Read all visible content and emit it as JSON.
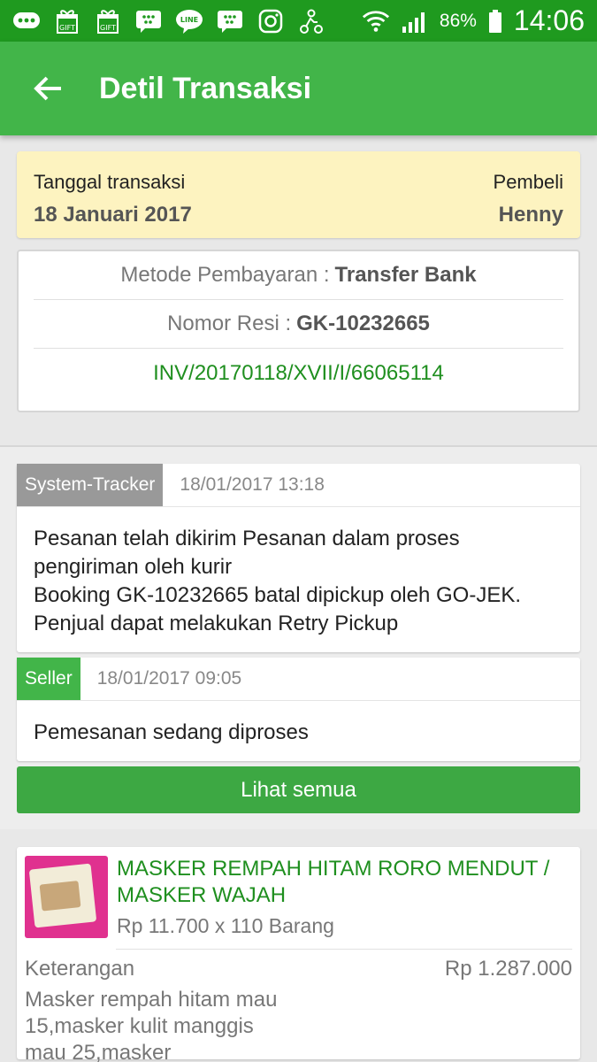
{
  "status_bar": {
    "battery": "86%",
    "time": "14:06",
    "icons": [
      "more-chat-icon",
      "gift-icon",
      "gift-icon",
      "bbm-icon",
      "line-icon",
      "bbm-icon",
      "instagram-icon",
      "gojek-icon"
    ]
  },
  "appbar": {
    "title": "Detil Transaksi"
  },
  "summary": {
    "date_label": "Tanggal transaksi",
    "date_value": "18 Januari 2017",
    "buyer_label": "Pembeli",
    "buyer_value": "Henny"
  },
  "info": {
    "payment_label": "Metode Pembayaran :",
    "payment_value": "Transfer Bank",
    "receipt_label": "Nomor Resi :",
    "receipt_value": "GK-10232665",
    "invoice": "INV/20170118/XVII/I/66065114"
  },
  "tracking": [
    {
      "tag": "System-Tracker",
      "time": "18/01/2017 13:18",
      "lines": [
        "Pesanan telah dikirim Pesanan dalam proses pengiriman oleh kurir",
        "Booking GK-10232665 batal dipickup oleh GO-JEK. Penjual dapat melakukan Retry Pickup"
      ]
    },
    {
      "tag": "Seller",
      "time": "18/01/2017 09:05",
      "lines": [
        "Pemesanan sedang diproses"
      ]
    }
  ],
  "see_all_label": "Lihat semua",
  "product": {
    "name": "MASKER REMPAH HITAM RORO MENDUT / MASKER WAJAH",
    "price": "Rp 11.700 x 110 Barang",
    "note_label": "Keterangan",
    "total": "Rp 1.287.000",
    "note": "Masker rempah hitam mau 15,masker kulit manggis mau 25,masker"
  },
  "colors": {
    "status_bar": "#1f9a1f",
    "appbar": "#42b549",
    "summary_bg": "#fdf3c0",
    "link": "#1f8f1f",
    "tracker_tag": "#999999"
  }
}
